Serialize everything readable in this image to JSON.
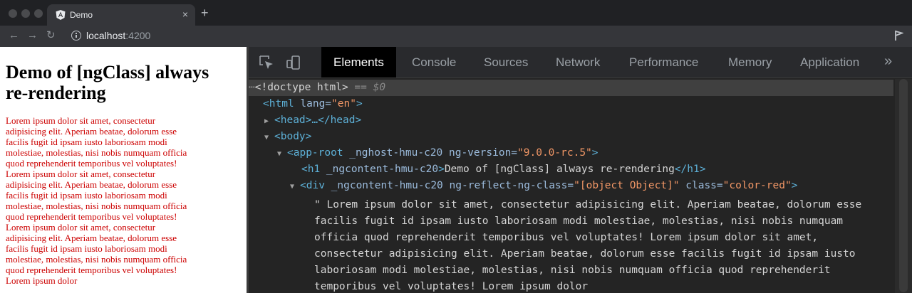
{
  "browser": {
    "tab_title": "Demo",
    "tab_close": "×",
    "new_tab": "+",
    "nav": {
      "back": "←",
      "forward": "→",
      "reload": "↻"
    },
    "url_host": "localhost",
    "url_port": ":4200"
  },
  "page": {
    "heading": "Demo of [ngClass] always re-rendering",
    "paragraph": "Lorem ipsum dolor sit amet, consectetur adipisicing elit. Aperiam beatae, dolorum esse facilis fugit id ipsam iusto laboriosam modi molestiae, molestias, nisi nobis numquam officia quod reprehenderit temporibus vel voluptates! Lorem ipsum dolor sit amet, consectetur adipisicing elit. Aperiam beatae, dolorum esse facilis fugit id ipsam iusto laboriosam modi molestiae, molestias, nisi nobis numquam officia quod reprehenderit temporibus vel voluptates! Lorem ipsum dolor sit amet, consectetur adipisicing elit. Aperiam beatae, dolorum esse facilis fugit id ipsam iusto laboriosam modi molestiae, molestias, nisi nobis numquam officia quod reprehenderit temporibus vel voluptates! Lorem ipsum dolor"
  },
  "devtools": {
    "tabs": [
      "Elements",
      "Console",
      "Sources",
      "Network",
      "Performance",
      "Memory",
      "Application"
    ],
    "more": "»",
    "lines": {
      "doctype": "<!doctype html>",
      "doctype_eq": " == ",
      "doctype_var": "$0",
      "html_open": "<html",
      "html_attr": " lang=",
      "html_val": "\"en\"",
      "html_close": ">",
      "head": "<head>…</head>",
      "body": "<body>",
      "app_open": "<app-root",
      "app_attr1": " _nghost-hmu-c20",
      "app_attr2": " ng-version=",
      "app_val2": "\"9.0.0-rc.5\"",
      "app_close": ">",
      "h1_open": "<h1",
      "h1_attr": " _ngcontent-hmu-c20",
      "h1_gt": ">",
      "h1_text": "Demo of [ngClass] always re-rendering",
      "h1_close": "</h1>",
      "div_open": "<div",
      "div_attr1": " _ngcontent-hmu-c20",
      "div_attr2": " ng-reflect-ng-class=",
      "div_val2": "\"[object Object]\"",
      "div_attr3": " class=",
      "div_val3": "\"color-red\"",
      "div_close": ">",
      "text_node": "\" Lorem ipsum dolor sit amet, consectetur adipisicing elit. Aperiam beatae, dolorum esse facilis fugit id ipsam iusto laboriosam modi molestiae, molestias, nisi nobis numquam officia quod reprehenderit temporibus vel voluptates! Lorem ipsum dolor sit amet, consectetur adipisicing elit. Aperiam beatae, dolorum esse facilis fugit id ipsam iusto laboriosam modi molestiae, molestias, nisi nobis numquam officia quod reprehenderit temporibus vel voluptates! Lorem ipsum dolor"
    }
  },
  "colors": {
    "accent_red": "#cc0000",
    "devtools_bg": "#242424"
  }
}
